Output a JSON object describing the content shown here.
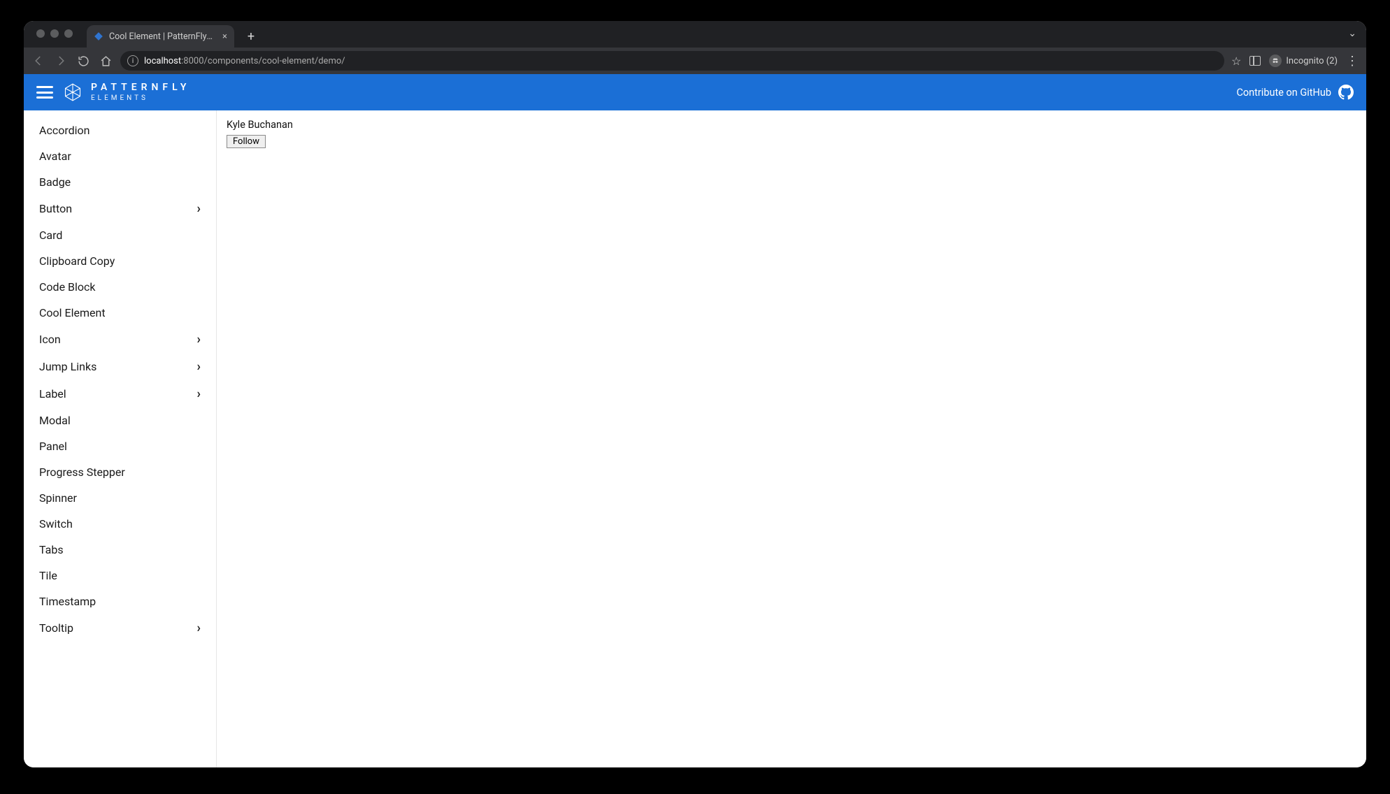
{
  "browser": {
    "tab_title": "Cool Element | PatternFly Elem…",
    "url_host": "localhost",
    "url_rest": ":8000/components/cool-element/demo/",
    "incognito_label": "Incognito (2)"
  },
  "header": {
    "brand_line1": "PATTERNFLY",
    "brand_line2": "ELEMENTS",
    "contribute": "Contribute on GitHub"
  },
  "sidebar": {
    "items": [
      {
        "label": "Accordion",
        "expandable": false
      },
      {
        "label": "Avatar",
        "expandable": false
      },
      {
        "label": "Badge",
        "expandable": false
      },
      {
        "label": "Button",
        "expandable": true
      },
      {
        "label": "Card",
        "expandable": false
      },
      {
        "label": "Clipboard Copy",
        "expandable": false
      },
      {
        "label": "Code Block",
        "expandable": false
      },
      {
        "label": "Cool Element",
        "expandable": false
      },
      {
        "label": "Icon",
        "expandable": true
      },
      {
        "label": "Jump Links",
        "expandable": true
      },
      {
        "label": "Label",
        "expandable": true
      },
      {
        "label": "Modal",
        "expandable": false
      },
      {
        "label": "Panel",
        "expandable": false
      },
      {
        "label": "Progress Stepper",
        "expandable": false
      },
      {
        "label": "Spinner",
        "expandable": false
      },
      {
        "label": "Switch",
        "expandable": false
      },
      {
        "label": "Tabs",
        "expandable": false
      },
      {
        "label": "Tile",
        "expandable": false
      },
      {
        "label": "Timestamp",
        "expandable": false
      },
      {
        "label": "Tooltip",
        "expandable": true
      }
    ]
  },
  "main": {
    "person_name": "Kyle Buchanan",
    "follow_label": "Follow"
  }
}
